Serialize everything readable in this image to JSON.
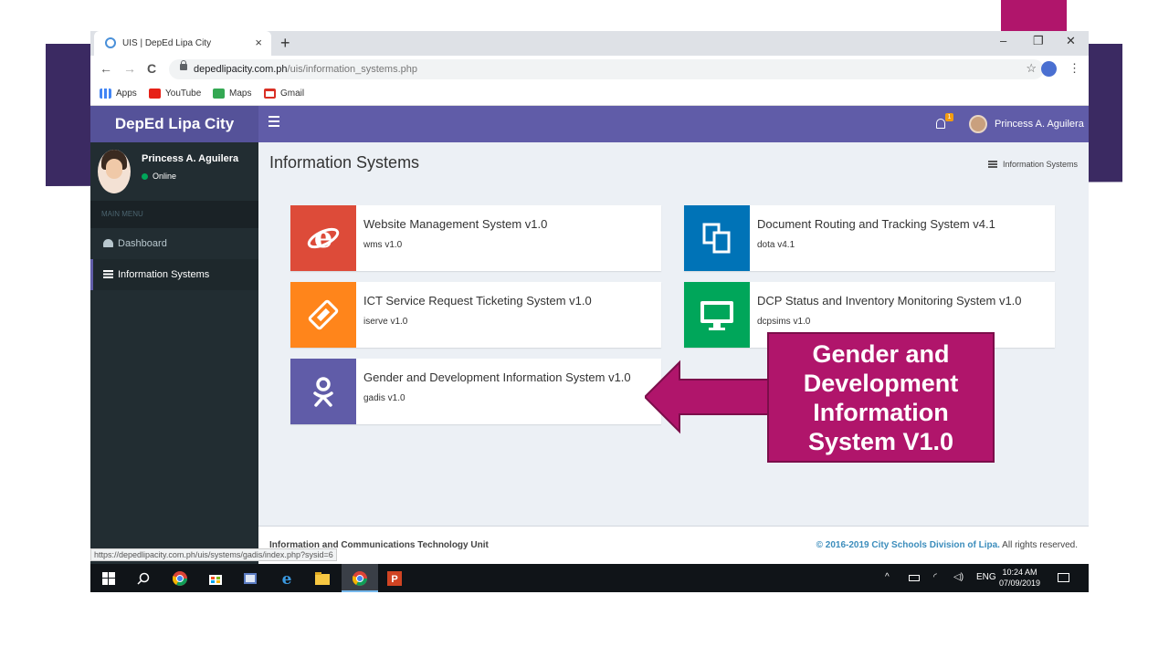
{
  "browser": {
    "tab_title": "UIS | DepEd Lipa City",
    "tab_close": "×",
    "new_tab": "+",
    "window_controls": [
      "–",
      "❐",
      "✕"
    ],
    "url_domain": "depedlipacity.com.ph",
    "url_path": "/uis/information_systems.php",
    "nav": [
      "←",
      "→",
      "C"
    ],
    "star": "☆",
    "menu": "⋮",
    "bookmarks": [
      {
        "label": "Apps",
        "color": "#4285f4"
      },
      {
        "label": "YouTube",
        "color": "#e62117"
      },
      {
        "label": "Maps",
        "color": "#34a853"
      },
      {
        "label": "Gmail",
        "color": "#d93025"
      }
    ]
  },
  "app": {
    "brand": "DepEd Lipa City",
    "header_color": "#605ca8",
    "notification_count": "1",
    "user_name": "Princess A. Aguilera"
  },
  "sidebar": {
    "user_name": "Princess A. Aguilera",
    "status": "Online",
    "menu_header": "MAIN MENU",
    "items": [
      {
        "label": "Dashboard",
        "icon": "dashboard-icon"
      },
      {
        "label": "Information Systems",
        "icon": "list-icon"
      }
    ]
  },
  "main": {
    "title": "Information Systems",
    "breadcrumb": "Information Systems",
    "cards": [
      {
        "title": "Website Management System v1.0",
        "sub": "wms v1.0",
        "color": "#dd4b39",
        "icon": "internet-explorer-icon"
      },
      {
        "title": "Document Routing and Tracking System v4.1",
        "sub": "dota v4.1",
        "color": "#0073b7",
        "icon": "documents-icon"
      },
      {
        "title": "ICT Service Request Ticketing System v1.0",
        "sub": "iserve v1.0",
        "color": "#ff851b",
        "icon": "ticket-icon"
      },
      {
        "title": "DCP Status and Inventory Monitoring System v1.0",
        "sub": "dcpsims v1.0",
        "color": "#00a65a",
        "icon": "monitor-icon"
      },
      {
        "title": "Gender and Development Information System v1.0",
        "sub": "gadis v1.0",
        "color": "#605ca8",
        "icon": "odnoklassniki-icon"
      }
    ]
  },
  "footer": {
    "left": "Information and Communications Technology Unit",
    "copyright": "© 2016-2019 City Schools Division of Lipa.",
    "rights": " All rights reserved."
  },
  "status_url": "https://depedlipacity.com.ph/uis/systems/gadis/index.php?sysid=6",
  "taskbar": {
    "language": "ENG",
    "time": "10:24 AM",
    "date": "07/09/2019"
  },
  "callout": {
    "text": "Gender and Development Information System V1.0",
    "color": "#b0156b"
  }
}
